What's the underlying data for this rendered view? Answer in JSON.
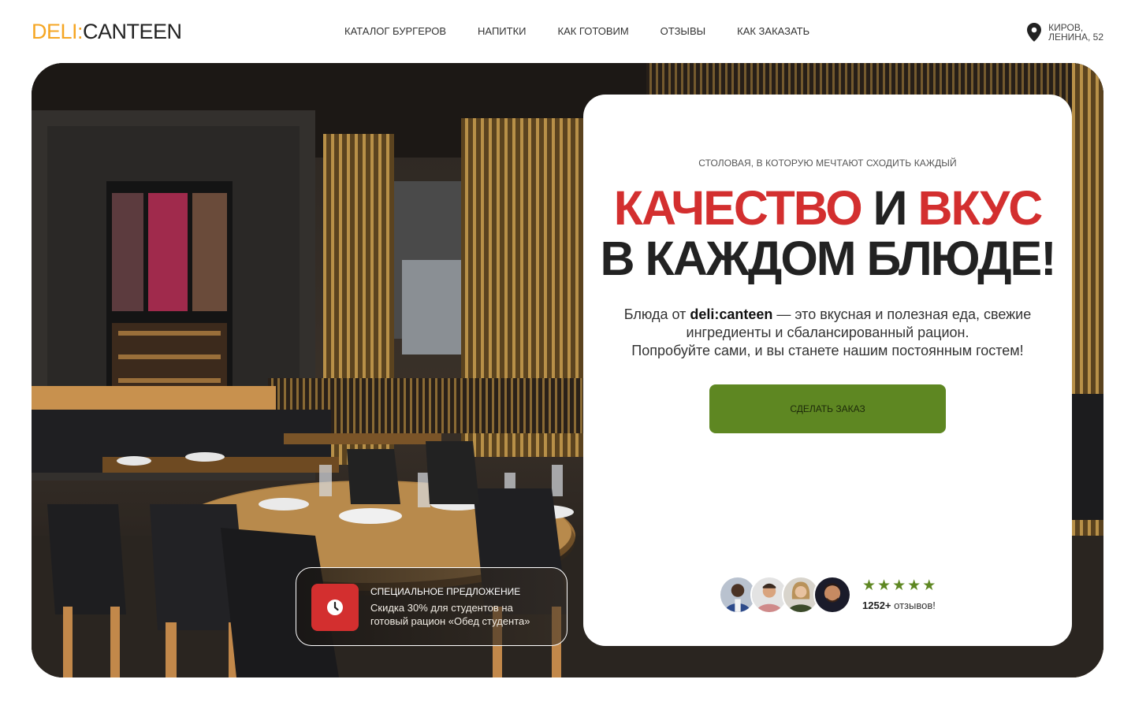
{
  "header": {
    "logo_part1": "DELI:",
    "logo_part2": "CANTEEN",
    "nav": [
      {
        "label": "КАТАЛОГ БУРГЕРОВ"
      },
      {
        "label": "НАПИТКИ"
      },
      {
        "label": "КАК ГОТОВИМ"
      },
      {
        "label": "ОТЗЫВЫ"
      },
      {
        "label": "КАК ЗАКАЗАТЬ"
      }
    ],
    "address_line1": "КИРОВ,",
    "address_line2": "ЛЕНИНА, 52",
    "address_icon": "location-pin-icon"
  },
  "hero": {
    "eyebrow": "СТОЛОВАЯ, В КОТОРУЮ МЕЧТАЮТ СХОДИТЬ КАЖДЫЙ",
    "title_word1": "КАЧЕСТВО",
    "title_and": " И ",
    "title_word2": "ВКУС",
    "title_line2": "В КАЖДОМ БЛЮДЕ!",
    "desc_pre": "Блюда от ",
    "desc_brand": "deli:canteen",
    "desc_rest1": " — это вкусная и полезная еда, свежие ингредиенты и сбалансированный рацион.",
    "desc_rest2": "Попробуйте сами, и вы станете нашим постоянным гостем!",
    "cta_label": "СДЕЛАТЬ ЗАКАЗ",
    "rating_stars": 5,
    "reviews_count": "1252+",
    "reviews_label": " отзывов!"
  },
  "offer": {
    "title": "СПЕЦИАЛЬНОЕ ПРЕДЛОЖЕНИЕ",
    "text": "Скидка 30% для студентов на готовый рацион «Обед студента»",
    "icon": "clock-icon"
  },
  "colors": {
    "accent_red": "#d32f2f",
    "accent_green": "#5e8722",
    "logo_orange": "#f5a623"
  }
}
